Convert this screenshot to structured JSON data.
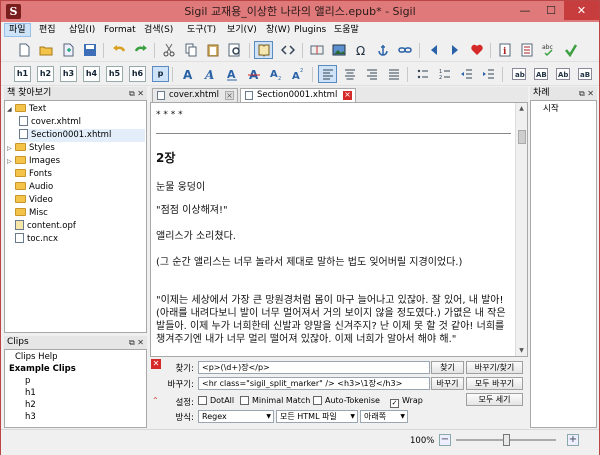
{
  "window": {
    "title": "Sigil 교재용_이상한 나라의 앨리스.epub* - Sigil",
    "app_icon_letter": "S",
    "minimize": "—",
    "maximize": "☐",
    "close": "✕"
  },
  "menu": [
    "파일",
    "편집",
    "삽입(I)",
    "Format",
    "검색(S)",
    "도구(T)",
    "보기(V)",
    "창(W)",
    "Plugins",
    "도움말"
  ],
  "toolbar2": {
    "headings": [
      "h1",
      "h2",
      "h3",
      "h4",
      "h5",
      "h6",
      "p"
    ]
  },
  "book_browser": {
    "title": "책 찾아보기",
    "controls": "⧉ ✕",
    "items": [
      {
        "label": "Text",
        "type": "folder",
        "expanded": true
      },
      {
        "label": "cover.xhtml",
        "type": "doc"
      },
      {
        "label": "Section0001.xhtml",
        "type": "doc",
        "selected": true
      },
      {
        "label": "Styles",
        "type": "folder"
      },
      {
        "label": "Images",
        "type": "folder"
      },
      {
        "label": "Fonts",
        "type": "folder"
      },
      {
        "label": "Audio",
        "type": "folder"
      },
      {
        "label": "Video",
        "type": "folder"
      },
      {
        "label": "Misc",
        "type": "folder"
      },
      {
        "label": "content.opf",
        "type": "opf"
      },
      {
        "label": "toc.ncx",
        "type": "doc"
      }
    ]
  },
  "clips": {
    "title": "Clips",
    "controls": "⧉ ✕",
    "items": [
      {
        "label": "Clips Help",
        "bold": false
      },
      {
        "label": "Example Clips",
        "bold": true
      },
      {
        "label": "p",
        "bold": false
      },
      {
        "label": "h1",
        "bold": false
      },
      {
        "label": "h2",
        "bold": false
      },
      {
        "label": "h3",
        "bold": false
      }
    ]
  },
  "toc_panel": {
    "title": "차례",
    "controls": "⧉ ✕",
    "items": [
      "시작"
    ]
  },
  "tabs": [
    {
      "label": "cover.xhtml",
      "active": false
    },
    {
      "label": "Section0001.xhtml",
      "active": true
    }
  ],
  "editor": {
    "stars": "* * * *",
    "heading": "2장",
    "paragraphs": [
      "눈물 웅덩이",
      "\"점점 이상해져!\"",
      "앨리스가 소리쳤다.",
      "(그 순간 앨리스는 너무 놀라서 제대로 말하는 법도 잊어버릴 지경이었다.)",
      "\"이제는 세상에서 가장 큰 망원경처럼 몸이 마구 늘어나고 있잖아. 잘 있어, 내 발아! (아래를 내려다보니 발이 너무 멀어져서 거의 보이지 않을 정도였다.) 가엾은 내 작은 발들아. 이제 누가 너희한테 신발과 양말을 신겨주지? 난 이제 못 할 것 같아! 너희를 챙겨주기엔 내가 너무 멀리 떨어져 있잖아. 이제 너희가 알아서 해야 해.\""
    ]
  },
  "find_replace": {
    "close_icon": "✕",
    "find_label": "찾기:",
    "find_value": "<p>(\\d+)장</p>",
    "replace_label": "바꾸기:",
    "replace_value": "<hr class=\"sigil_split_marker\" /> <h3>\\1장</h3>",
    "find_button": "찾기",
    "replace_find_button": "바꾸기/찾기",
    "replace_button": "바꾸기",
    "replace_all_button": "모두 바꾸기",
    "options_label": "설정:",
    "options": [
      {
        "label": "DotAll",
        "checked": false
      },
      {
        "label": "Minimal Match",
        "checked": false
      },
      {
        "label": "Auto-Tokenise",
        "checked": false
      },
      {
        "label": "Wrap",
        "checked": true
      }
    ],
    "count_all_button": "모두 세기",
    "mode_label": "방식:",
    "mode_value": "Regex",
    "scope_value": "모든 HTML 파일",
    "direction_value": "아래쪽"
  },
  "status": {
    "zoom": "100%",
    "zoom_level": 0.5,
    "zoom_out": "−",
    "zoom_in": "+"
  },
  "colors": {
    "titlebar": "#e07a7a",
    "close": "#c73c3c",
    "accent": "#3a78c2"
  }
}
